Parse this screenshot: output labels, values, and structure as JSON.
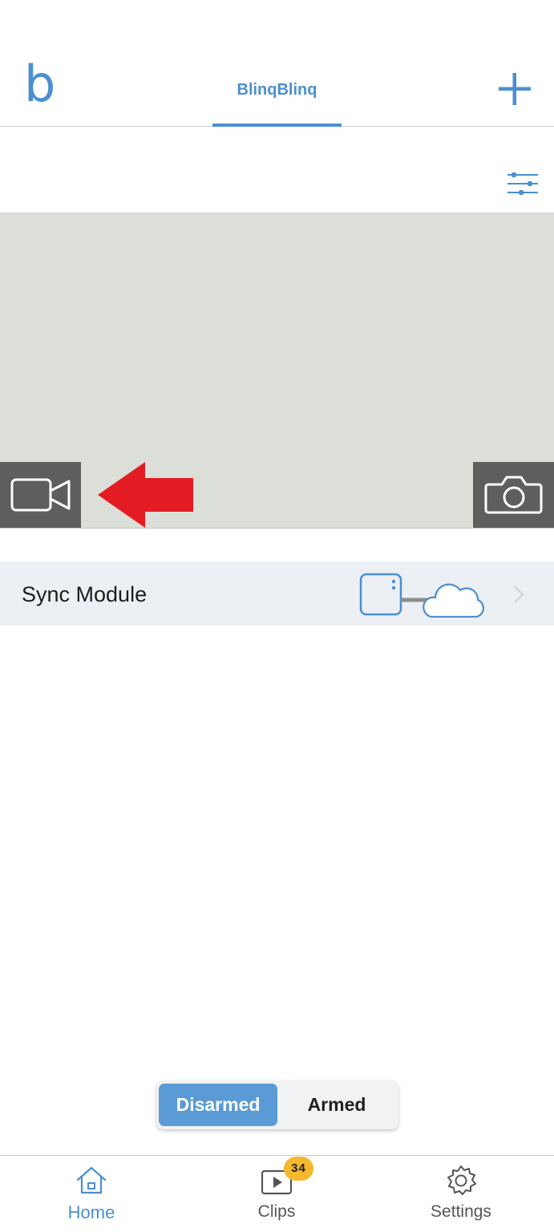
{
  "header": {
    "logo_text": "b",
    "active_tab": "BlinqBlinq",
    "add_icon": "plus-icon"
  },
  "toolbar": {
    "filter_icon": "sliders-icon"
  },
  "camera": {
    "record_icon": "video-camera-icon",
    "snapshot_icon": "camera-icon",
    "annotation_icon": "red-arrow-icon",
    "annotation_color": "#e31b23"
  },
  "sync_module": {
    "label": "Sync Module",
    "status_icon": "sync-module-cloud-icon",
    "chevron_icon": "chevron-right-icon"
  },
  "arm_toggle": {
    "disarmed_label": "Disarmed",
    "armed_label": "Armed",
    "selected": "Disarmed"
  },
  "bottom_nav": {
    "items": [
      {
        "label": "Home",
        "icon": "home-icon",
        "active": true
      },
      {
        "label": "Clips",
        "icon": "play-icon",
        "badge": "34"
      },
      {
        "label": "Settings",
        "icon": "gear-icon"
      }
    ]
  },
  "colors": {
    "accent": "#4b8fd1",
    "toggle_selected": "#5a9bd5",
    "badge": "#f5b82e",
    "camera_bg": "#dbdfd7",
    "sync_row_bg": "#eceff3"
  }
}
